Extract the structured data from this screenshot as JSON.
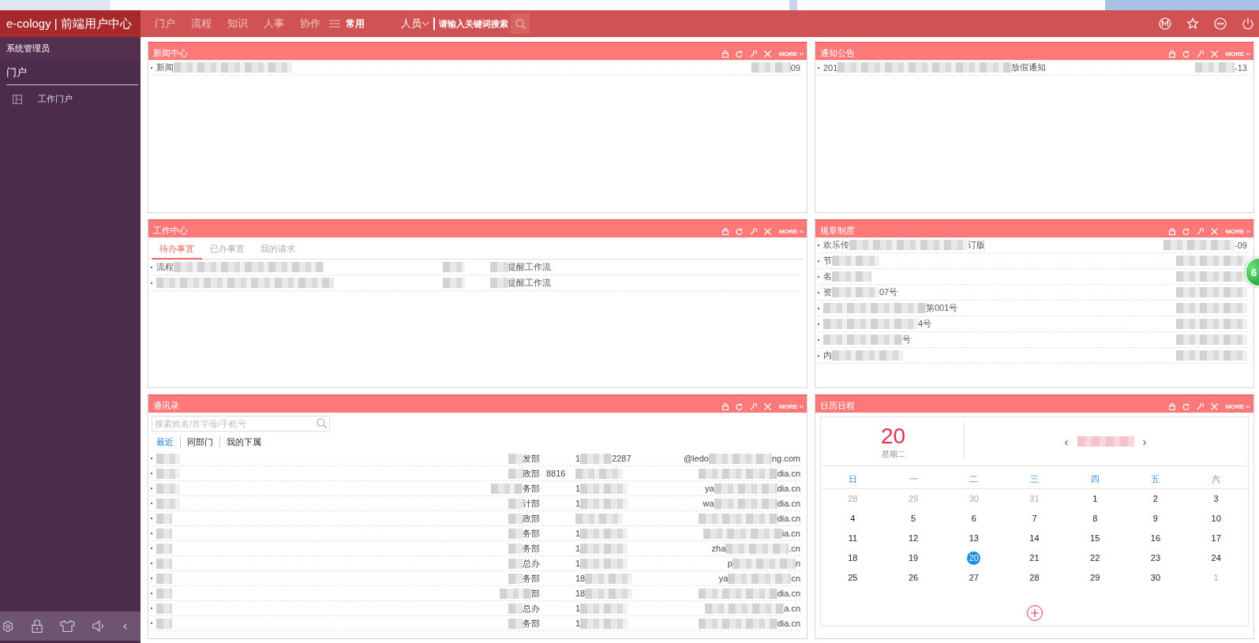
{
  "header": {
    "logo": "e-cology | 前端用户中心",
    "nav": [
      "门户",
      "流程",
      "知识",
      "人事",
      "协作"
    ],
    "common": "常用",
    "search_scope": "人员",
    "search_placeholder": "请输入关键词搜索"
  },
  "sidebar": {
    "user": "系统管理员",
    "section": "门户",
    "items": [
      "工作门户"
    ]
  },
  "panels": [
    {
      "kind": "list",
      "title": "新闻中心",
      "more": "MORE ››",
      "rows": [
        {
          "lead": "新闻",
          "date": "09"
        }
      ]
    },
    {
      "kind": "list",
      "title": "通知公告",
      "more": "MORE ››",
      "rows": [
        {
          "lead": "201",
          "trail": "放假通知",
          "date": "-13"
        }
      ]
    },
    {
      "kind": "work",
      "title": "工作中心",
      "more": "MORE ››",
      "tabs": [
        {
          "label": "待办事宜",
          "selected": true
        },
        {
          "label": "已办事宜",
          "selected": false
        },
        {
          "label": "我的请求",
          "selected": false
        }
      ],
      "rows": [
        {
          "lead": "流程",
          "trail": "提醒工作流"
        },
        {
          "trail": "提醒工作流"
        }
      ]
    },
    {
      "kind": "list",
      "title": "规章制度",
      "more": "MORE ››",
      "rows": [
        {
          "lead": "欢乐传",
          "trail": "订版",
          "date": "-09"
        },
        {
          "lead": "节"
        },
        {
          "lead": "名"
        },
        {
          "lead": "资",
          "trail": "07号"
        },
        {
          "trail": "第001号"
        },
        {
          "trail": "4号"
        },
        {
          "trail": "号"
        },
        {
          "lead": "内"
        }
      ]
    },
    {
      "kind": "contacts",
      "title": "通讯录",
      "more": "MORE ››",
      "placeholder": "搜索姓名/首字母/手机号",
      "tabs": [
        {
          "label": "最近",
          "selected": true
        },
        {
          "label": "同部门",
          "selected": false
        },
        {
          "label": "我的下属",
          "selected": false
        }
      ],
      "rows": [
        {
          "dept": "发部",
          "phone_lead": "1",
          "phone": "2287",
          "email_lead": "@ledo",
          "email": "ng.com"
        },
        {
          "dept": "政部",
          "ext": "8816",
          "email": "dia.cn"
        },
        {
          "dept": "务部",
          "phone_lead": "1",
          "email_lead": "ya",
          "email": "dia.cn"
        },
        {
          "dept": "计部",
          "phone_lead": "1",
          "email_lead": "wa",
          "email": "dia.cn"
        },
        {
          "dept": "政部",
          "email": "dia.cn"
        },
        {
          "dept": "务部",
          "phone_lead": "1",
          "email": "ia.cn"
        },
        {
          "dept": "务部",
          "phone_lead": "1",
          "email_lead": "zha",
          "email": ".cn"
        },
        {
          "dept": "总办",
          "phone_lead": "1",
          "email_lead": "p",
          "email": "n"
        },
        {
          "dept": "务部",
          "phone_lead": "18",
          "email_lead": "ya",
          "email": "cn"
        },
        {
          "dept": "部",
          "phone_lead": "18",
          "email": "dia.cn"
        },
        {
          "dept": "总办",
          "phone_lead": "1",
          "email": "a.cn"
        },
        {
          "dept": "务部",
          "phone_lead": "1",
          "email": "dia.cn"
        }
      ]
    },
    {
      "kind": "calendar",
      "title": "日历日程",
      "more": "MORE ››",
      "day": "20",
      "weekday": "星期二",
      "prev": "‹",
      "next": "›",
      "weekdays": [
        "日",
        "一",
        "二",
        "三",
        "四",
        "五",
        "六"
      ],
      "weeks": [
        [
          {
            "label": "28",
            "outside": true,
            "selected": false
          },
          {
            "label": "29",
            "outside": true,
            "selected": false
          },
          {
            "label": "30",
            "outside": true,
            "selected": false
          },
          {
            "label": "31",
            "outside": true,
            "selected": false
          },
          {
            "label": "1",
            "outside": false,
            "selected": false
          },
          {
            "label": "2",
            "outside": false,
            "selected": false
          },
          {
            "label": "3",
            "outside": false,
            "selected": false
          }
        ],
        [
          {
            "label": "4",
            "outside": false,
            "selected": false
          },
          {
            "label": "5",
            "outside": false,
            "selected": false
          },
          {
            "label": "6",
            "outside": false,
            "selected": false
          },
          {
            "label": "7",
            "outside": false,
            "selected": false
          },
          {
            "label": "8",
            "outside": false,
            "selected": false
          },
          {
            "label": "9",
            "outside": false,
            "selected": false
          },
          {
            "label": "10",
            "outside": false,
            "selected": false
          }
        ],
        [
          {
            "label": "11",
            "outside": false,
            "selected": false
          },
          {
            "label": "12",
            "outside": false,
            "selected": false
          },
          {
            "label": "13",
            "outside": false,
            "selected": false
          },
          {
            "label": "14",
            "outside": false,
            "selected": false
          },
          {
            "label": "15",
            "outside": false,
            "selected": false
          },
          {
            "label": "16",
            "outside": false,
            "selected": false
          },
          {
            "label": "17",
            "outside": false,
            "selected": false
          }
        ],
        [
          {
            "label": "18",
            "outside": false,
            "selected": false
          },
          {
            "label": "19",
            "outside": false,
            "selected": false
          },
          {
            "label": "20",
            "outside": false,
            "selected": true
          },
          {
            "label": "21",
            "outside": false,
            "selected": false
          },
          {
            "label": "22",
            "outside": false,
            "selected": false
          },
          {
            "label": "23",
            "outside": false,
            "selected": false
          },
          {
            "label": "24",
            "outside": false,
            "selected": false
          }
        ],
        [
          {
            "label": "25",
            "outside": false,
            "selected": false
          },
          {
            "label": "26",
            "outside": false,
            "selected": false
          },
          {
            "label": "27",
            "outside": false,
            "selected": false
          },
          {
            "label": "28",
            "outside": false,
            "selected": false
          },
          {
            "label": "29",
            "outside": false,
            "selected": false
          },
          {
            "label": "30",
            "outside": false,
            "selected": false
          },
          {
            "label": "1",
            "outside": true,
            "selected": false
          }
        ]
      ]
    }
  ],
  "floating_badge": "6"
}
